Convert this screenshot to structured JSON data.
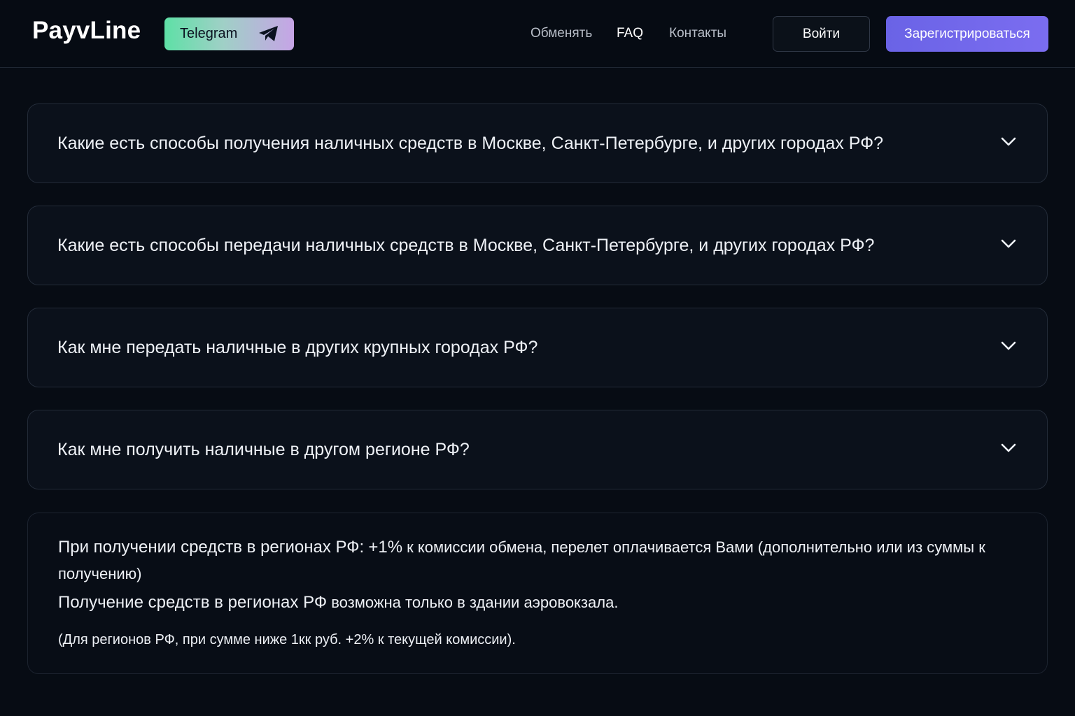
{
  "header": {
    "logo": "PayvLine",
    "telegram_label": "Telegram",
    "nav": [
      {
        "label": "Обменять"
      },
      {
        "label": "FAQ"
      },
      {
        "label": "Контакты"
      }
    ],
    "login_label": "Войти",
    "register_label": "Зарегистрироваться"
  },
  "faq": [
    {
      "question": "Какие есть способы получения наличных средств в Москве, Санкт-Петербурге, и других городах РФ?"
    },
    {
      "question": "Какие есть способы передачи наличных средств в Москве, Санкт-Петербурге, и других городах РФ?"
    },
    {
      "question": "Как мне передать наличные в других крупных городах РФ?"
    },
    {
      "question": "Как мне получить наличные в другом регионе РФ?"
    }
  ],
  "info": {
    "p1_lead": "При получении средств в регионах РФ:",
    "p1_pct": "+1%",
    "p1_rest": "к комиссии обмена, перелет оплачивается Вами (дополнительно или из суммы к получению)",
    "p2_lead": "Получение средств в регионах РФ",
    "p2_rest": "возможна только в здании аэровокзала.",
    "p3": "(Для регионов РФ, при сумме ниже 1кк руб. +2% к текущей комиссии)."
  },
  "colors": {
    "background": "#070c14",
    "accent": "#6a63e6",
    "telegram_gradient_start": "#5ee0a6",
    "telegram_gradient_end": "#c6a4e6"
  }
}
